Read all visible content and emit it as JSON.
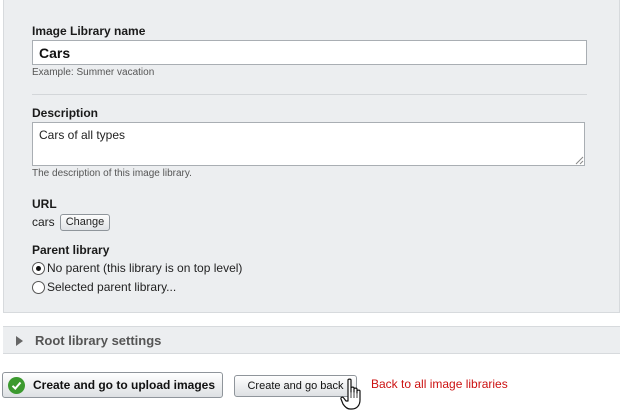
{
  "form": {
    "name_label": "Image Library name",
    "name_value": "Cars",
    "name_hint": "Example: Summer vacation",
    "description_label": "Description",
    "description_value": "Cars of all types",
    "description_hint": "The description of this image library.",
    "url_label": "URL",
    "url_value": "cars",
    "change_button": "Change",
    "parent_label": "Parent library",
    "parent_options": [
      {
        "label": "No parent (this library is on top level)",
        "checked": true
      },
      {
        "label": "Selected parent library...",
        "checked": false
      }
    ]
  },
  "root_settings": {
    "title": "Root library settings",
    "expanded": false
  },
  "actions": {
    "primary_label": "Create and go to upload images",
    "secondary_label": "Create and go back",
    "back_link": "Back to all image libraries"
  },
  "colors": {
    "panel_bg": "#eceef0",
    "link": "#cc1111",
    "check": "#3c9a2f"
  },
  "icons": {
    "check": "check-circle-icon",
    "expand": "triangle-right-icon",
    "cursor": "hand-pointer-icon"
  }
}
